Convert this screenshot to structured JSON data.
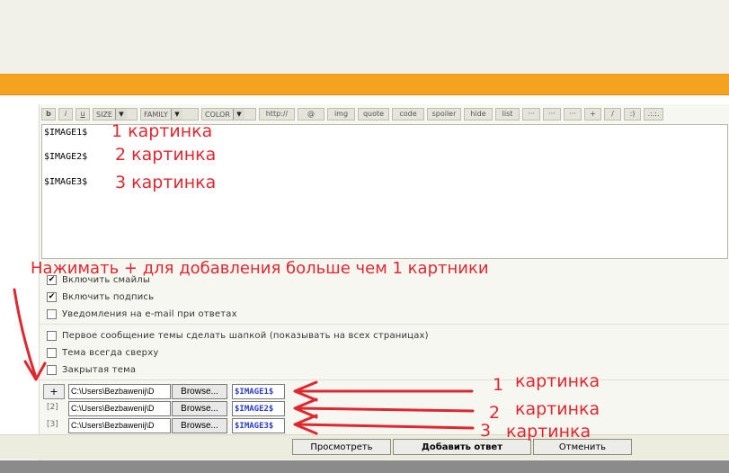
{
  "toolbar": {
    "bold": "b",
    "italic": "i",
    "underline": "u",
    "size": "SIZE",
    "family": "FAMILY",
    "color": "COLOR",
    "http": "http://",
    "at": "@",
    "img": "img",
    "quote": "quote",
    "code": "code",
    "spoiler": "spoiler",
    "hide": "hide",
    "list": "list",
    "b1": "···",
    "b2": "···",
    "b3": "···",
    "plus": "+",
    "slash": "/",
    "smile": ":)",
    "dots": ".:.:."
  },
  "editor": {
    "line1": "$IMAGE1$",
    "line2": "$IMAGE2$",
    "line3": "$IMAGE3$"
  },
  "annotations": {
    "line1": "1 картинка",
    "line2": "2 картинка",
    "line3": "3 картинка",
    "hint": "Нажимать + для добавления больше чем 1 картники",
    "file1_num": "1",
    "file1_word": "картинка",
    "file2_num": "2",
    "file2_word": "картинка",
    "file3_num": "3",
    "file3_word": "картинка"
  },
  "options": {
    "smiles": {
      "label": "Включить смайлы",
      "checked": true
    },
    "signature": {
      "label": "Включить подпись",
      "checked": true
    },
    "email": {
      "label": "Уведомления на e-mail при ответах",
      "checked": false
    },
    "header": {
      "label": "Первое сообщение темы сделать шапкой (показывать на всех страницах)",
      "checked": false
    },
    "sticky": {
      "label": "Тема всегда сверху",
      "checked": false
    },
    "closed": {
      "label": "Закрытая тема",
      "checked": false
    }
  },
  "files": {
    "plus": "+",
    "idx2": "[2]",
    "idx3": "[3]",
    "path": "C:\\Users\\Bezbawenij\\D",
    "browse": "Browse...",
    "tag1": "$IMAGE1$",
    "tag2": "$IMAGE2$",
    "tag3": "$IMAGE3$"
  },
  "buttons": {
    "preview": "Просмотреть",
    "submit": "Добавить ответ",
    "cancel": "Отменить"
  },
  "colors": {
    "accent_orange": "#f4a21f",
    "annotation_red": "#e0272f",
    "tag_blue": "#2b3fc4"
  }
}
